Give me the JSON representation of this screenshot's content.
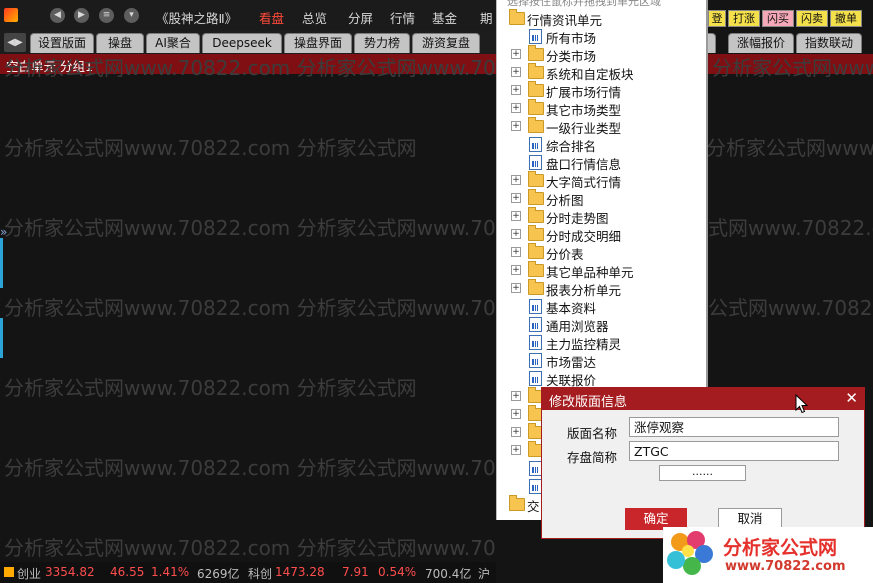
{
  "app": {
    "title": "《股神之路Ⅱ》",
    "menu": [
      "看盘",
      "总览",
      "分屏",
      "行情",
      "基金",
      "期"
    ],
    "active_menu": "看盘"
  },
  "tabs": [
    "设置版面",
    "操盘",
    "AI聚合",
    "Deepseek",
    "操盘界面",
    "势力榜",
    "游资复盘"
  ],
  "unit_bar": "空白单元 分组1",
  "watermark": {
    "lines": [
      "分析家公式网www.70822.com  分析家公式网www.70822.com",
      "分析家公式网www.70822.com  分析家公式网",
      "分析家公式网www.70822.com  分析家公式网www.70822.com"
    ]
  },
  "statusbar": {
    "items": [
      {
        "label": "创业",
        "value": "3354.82",
        "change": "46.55",
        "pct": "1.41%",
        "volume": "6269亿"
      },
      {
        "label": "科创",
        "value": "1473.28",
        "change": "7.91",
        "pct": "0.54%",
        "volume": "700.4亿"
      }
    ],
    "trailing": "沪"
  },
  "tree": {
    "top_hint": "选择按住鼠标并拖拽到单元区域",
    "root": "行情资讯单元",
    "items": [
      {
        "label": "所有市场",
        "type": "doc"
      },
      {
        "label": "分类市场",
        "type": "folder"
      },
      {
        "label": "系统和自定板块",
        "type": "folder"
      },
      {
        "label": "扩展市场行情",
        "type": "folder"
      },
      {
        "label": "其它市场类型",
        "type": "folder"
      },
      {
        "label": "一级行业类型",
        "type": "folder"
      },
      {
        "label": "综合排名",
        "type": "doc"
      },
      {
        "label": "盘口行情信息",
        "type": "doc"
      },
      {
        "label": "大字简式行情",
        "type": "folder"
      },
      {
        "label": "分析图",
        "type": "folder"
      },
      {
        "label": "分时走势图",
        "type": "folder"
      },
      {
        "label": "分时成交明细",
        "type": "folder"
      },
      {
        "label": "分价表",
        "type": "folder"
      },
      {
        "label": "其它单品种单元",
        "type": "folder"
      },
      {
        "label": "报表分析单元",
        "type": "folder"
      },
      {
        "label": "基本资料",
        "type": "doc"
      },
      {
        "label": "通用浏览器",
        "type": "doc"
      },
      {
        "label": "主力监控精灵",
        "type": "doc"
      },
      {
        "label": "市场雷达",
        "type": "doc"
      },
      {
        "label": "关联报价",
        "type": "doc"
      }
    ],
    "last_root": "交"
  },
  "right_panel": {
    "buttons": [
      "登",
      "打涨",
      "闪买",
      "闪卖",
      "撤单"
    ],
    "tabs": [
      "涨幅报价",
      "指数联动"
    ]
  },
  "dialog": {
    "title": "修改版面信息",
    "name_label": "版面名称",
    "name_value": "涨停观察",
    "short_label": "存盘简称",
    "short_value": "ZTGC",
    "dots": "......",
    "ok": "确定",
    "cancel": "取消"
  },
  "brand": {
    "name": "分析家公式网",
    "url": "www.70822.com"
  },
  "colors": {
    "accent_red": "#a51c20",
    "up_red": "#ff4d4d",
    "dark_bg": "#141414"
  }
}
